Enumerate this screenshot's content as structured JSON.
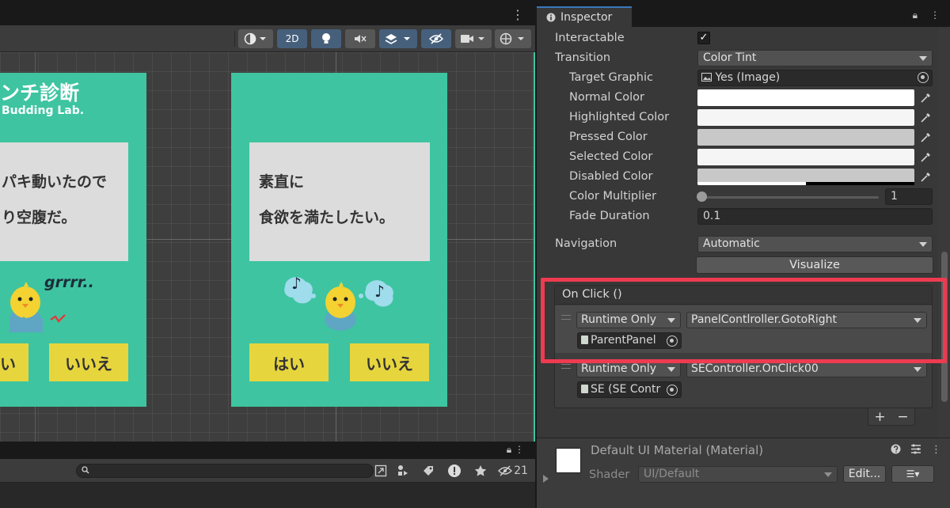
{
  "scene": {
    "toolbar": {
      "mode_2d_label": "2D"
    },
    "panel_left": {
      "title": "ンチ診断",
      "subtitle": "Budding Lab.",
      "text_line1": "パキ動いたので",
      "text_line2": "り空腹だ。",
      "speech": "grrrr..",
      "yes_label": "い",
      "no_label": "いいえ"
    },
    "panel_right": {
      "text_line1": "素直に",
      "text_line2": "食欲を満たしたい。",
      "yes_label": "はい",
      "no_label": "いいえ",
      "note_symbol": "♪"
    }
  },
  "bottom_bar": {
    "search_value": "",
    "hidden_count": "21"
  },
  "inspector": {
    "tab_label": "Inspector",
    "interactable": {
      "label": "Interactable",
      "checked": true,
      "check_glyph": "✓"
    },
    "transition": {
      "label": "Transition",
      "value": "Color Tint"
    },
    "target_graphic": {
      "label": "Target Graphic",
      "value": "Yes (Image)"
    },
    "normal_color": {
      "label": "Normal Color",
      "color": "#ffffff"
    },
    "highlighted_color": {
      "label": "Highlighted Color",
      "color": "#f5f5f5"
    },
    "pressed_color": {
      "label": "Pressed Color",
      "color": "#c8c8c8"
    },
    "selected_color": {
      "label": "Selected Color",
      "color": "#f5f5f5"
    },
    "disabled_color": {
      "label": "Disabled Color",
      "color": "#c8c8c8"
    },
    "color_multiplier": {
      "label": "Color Multiplier",
      "value": "1"
    },
    "fade_duration": {
      "label": "Fade Duration",
      "value": "0.1"
    },
    "navigation": {
      "label": "Navigation",
      "value": "Automatic"
    },
    "visualize_label": "Visualize",
    "on_click": {
      "header": "On Click ()",
      "entries": [
        {
          "mode": "Runtime Only",
          "function": "PanelContlroller.GotoRight",
          "object": "ParentPanel"
        },
        {
          "mode": "Runtime Only",
          "function": "SEController.OnClick00",
          "object": "SE (SE Contr"
        }
      ],
      "add_label": "+",
      "remove_label": "−"
    },
    "material": {
      "title": "Default UI Material (Material)",
      "shader_label": "Shader",
      "shader_value": "UI/Default",
      "edit_label": "Edit...",
      "list_label": "☰▾"
    }
  },
  "colors": {
    "panel_green": "#3ec4a1",
    "button_yellow": "#e7d53e",
    "highlight_red": "#ee3b50",
    "accent_blue": "#3a79bb"
  }
}
